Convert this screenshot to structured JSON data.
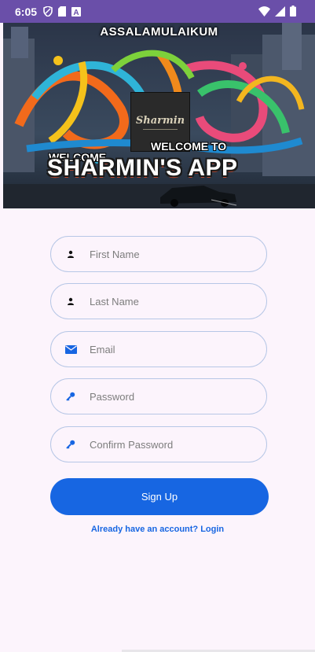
{
  "status_bar": {
    "time": "6:05"
  },
  "banner": {
    "greeting": "ASSALAMULAIKUM",
    "welcome_left": "WELCOME",
    "welcome_right": "WELCOME TO",
    "app_title": "SHARMIN'S APP",
    "logo_text": "Sharmin"
  },
  "form": {
    "first_name_placeholder": "First Name",
    "last_name_placeholder": "Last Name",
    "email_placeholder": "Email",
    "password_placeholder": "Password",
    "confirm_password_placeholder": "Confirm Password",
    "signup_label": "Sign Up",
    "login_link": "Already have an account? Login"
  },
  "colors": {
    "status_bar": "#6a4fa9",
    "accent": "#1766e2",
    "background": "#fcf4fc",
    "field_border": "#b7c7e6"
  }
}
